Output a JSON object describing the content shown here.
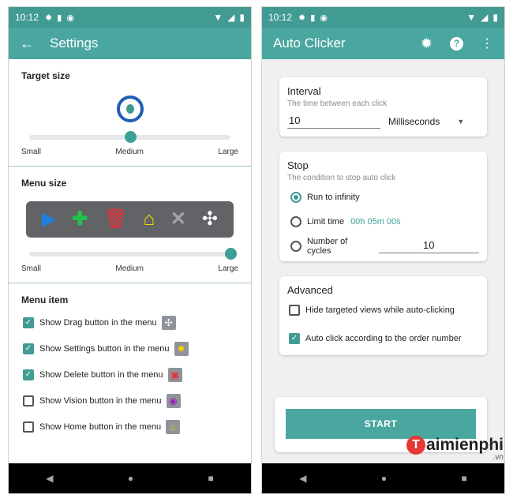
{
  "left": {
    "status": {
      "time": "10:12"
    },
    "appbar": {
      "title": "Settings"
    },
    "target_size": {
      "title": "Target size",
      "slider_value": 0.5,
      "labels": [
        "Small",
        "Medium",
        "Large"
      ]
    },
    "menu_size": {
      "title": "Menu size",
      "slider_value": 1.0,
      "labels": [
        "Small",
        "Medium",
        "Large"
      ],
      "preview_icons": [
        "play-icon",
        "plus-icon",
        "delete-icon",
        "home-icon",
        "close-icon",
        "drag-icon"
      ]
    },
    "menu_item": {
      "title": "Menu item",
      "items": [
        {
          "label": "Show Drag button in the menu",
          "checked": true,
          "icon": "drag-icon"
        },
        {
          "label": "Show Settings button in the menu",
          "checked": true,
          "icon": "gear-icon"
        },
        {
          "label": "Show Delete button in the menu",
          "checked": true,
          "icon": "delete-icon"
        },
        {
          "label": "Show Vision button in the menu",
          "checked": false,
          "icon": "eye-icon"
        },
        {
          "label": "Show Home button in the menu",
          "checked": false,
          "icon": "home-icon"
        }
      ]
    }
  },
  "right": {
    "status": {
      "time": "10:12"
    },
    "appbar": {
      "title": "Auto Clicker"
    },
    "interval": {
      "title": "Interval",
      "subtitle": "The time between each click",
      "value": "10",
      "unit": "Milliseconds"
    },
    "stop": {
      "title": "Stop",
      "subtitle": "The condition to stop auto click",
      "options": {
        "infinity": "Run to infinity",
        "limit_time": "Limit time",
        "limit_time_value": "00h 05m 00s",
        "cycles": "Number of cycles",
        "cycles_value": "10"
      },
      "selected": "infinity"
    },
    "advanced": {
      "title": "Advanced",
      "hide_targeted": "Hide targeted views while auto-clicking",
      "order_number": "Auto click according to the order number"
    },
    "start_label": "START"
  },
  "watermark": {
    "text": "aimienphi",
    "initial": "T",
    "domain": ".vn"
  }
}
